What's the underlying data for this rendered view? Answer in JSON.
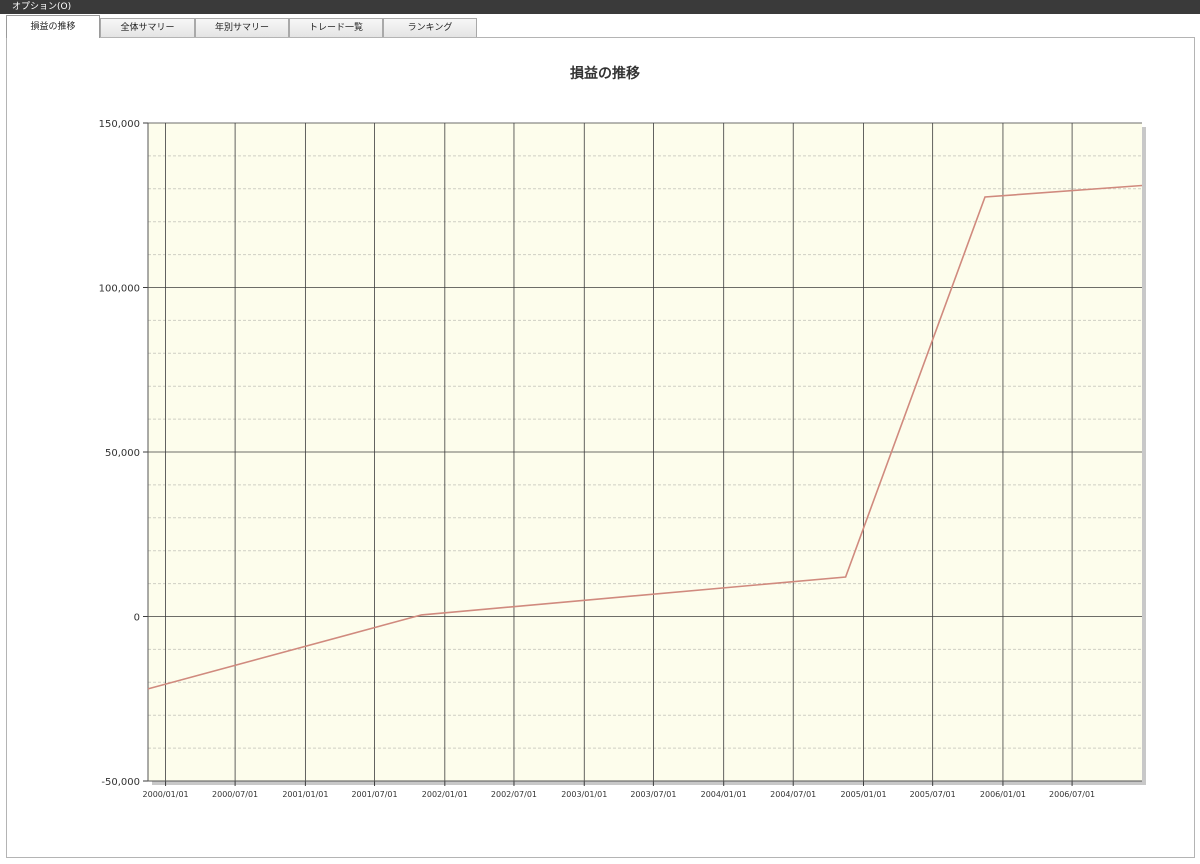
{
  "menubar": {
    "label": "オプション(O)"
  },
  "tabs": [
    {
      "label": "損益の推移",
      "active": true
    },
    {
      "label": "全体サマリー",
      "active": false
    },
    {
      "label": "年別サマリー",
      "active": false
    },
    {
      "label": "トレード一覧",
      "active": false
    },
    {
      "label": "ランキング",
      "active": false
    }
  ],
  "colors": {
    "plot_background": "#fdfdec",
    "line": "#d08a7e",
    "major_grid": "#3c3c3c",
    "minor_grid": "#cfcfc4"
  },
  "chart_data": {
    "type": "line",
    "title": "損益の推移",
    "xlabel": "",
    "ylabel": "",
    "ylim": [
      -50000,
      150000
    ],
    "yticks": [
      "150,000",
      "100,000",
      "50,000",
      "0",
      "-50,000"
    ],
    "xticks": [
      "2000/01/01",
      "2000/07/01",
      "2001/01/01",
      "2001/07/01",
      "2002/01/01",
      "2002/07/01",
      "2003/01/01",
      "2003/07/01",
      "2004/01/01",
      "2004/07/01",
      "2005/01/01",
      "2005/07/01",
      "2006/01/01",
      "2006/07/01"
    ],
    "xlim": [
      "1999-11-16",
      "2006-12-31"
    ],
    "grid": true,
    "series": [
      {
        "points": [
          {
            "x": "1999-11-16",
            "y": -22000
          },
          {
            "x": "2001-11-01",
            "y": 500
          },
          {
            "x": "2004-11-15",
            "y": 12000
          },
          {
            "x": "2005-11-15",
            "y": 127500
          },
          {
            "x": "2006-12-31",
            "y": 131000
          }
        ]
      }
    ]
  }
}
